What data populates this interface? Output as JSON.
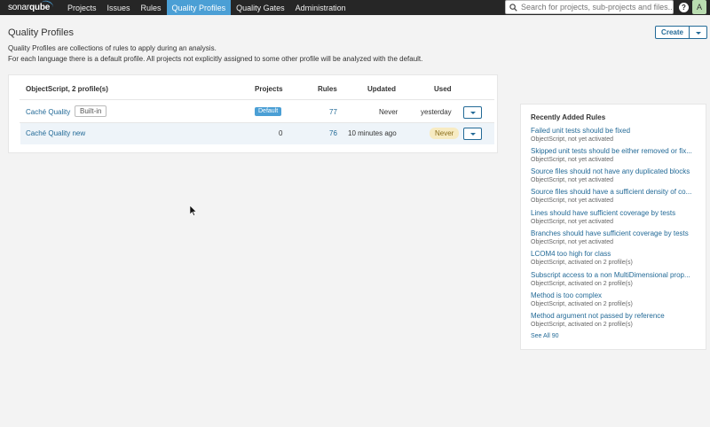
{
  "nav": {
    "logo_part1": "sonar",
    "logo_part2": "qube",
    "items": [
      {
        "label": "Projects",
        "active": false
      },
      {
        "label": "Issues",
        "active": false
      },
      {
        "label": "Rules",
        "active": false
      },
      {
        "label": "Quality Profiles",
        "active": true
      },
      {
        "label": "Quality Gates",
        "active": false
      },
      {
        "label": "Administration",
        "active": false
      }
    ],
    "search_placeholder": "Search for projects, sub-projects and files...",
    "help_label": "?",
    "avatar_letter": "A"
  },
  "page": {
    "title": "Quality Profiles",
    "description_line1": "Quality Profiles are collections of rules to apply during an analysis.",
    "description_line2": "For each language there is a default profile. All projects not explicitly assigned to some other profile will be analyzed with the default.",
    "create_label": "Create"
  },
  "profiles": {
    "header": {
      "language": "ObjectScript, 2 profile(s)",
      "projects": "Projects",
      "rules": "Rules",
      "updated": "Updated",
      "used": "Used"
    },
    "rows": [
      {
        "name": "Caché Quality",
        "builtin": "Built-in",
        "projects_badge": "Default",
        "projects": "",
        "rules": "77",
        "updated": "Never",
        "used": "yesterday"
      },
      {
        "name": "Caché Quality new",
        "builtin": "",
        "projects_badge": "",
        "projects": "0",
        "rules": "76",
        "updated": "10 minutes ago",
        "used": "Never"
      }
    ]
  },
  "recent_rules": {
    "title": "Recently Added Rules",
    "items": [
      {
        "name": "Failed unit tests should be fixed",
        "meta": "ObjectScript, not yet activated"
      },
      {
        "name": "Skipped unit tests should be either removed or fix...",
        "meta": "ObjectScript, not yet activated"
      },
      {
        "name": "Source files should not have any duplicated blocks",
        "meta": "ObjectScript, not yet activated"
      },
      {
        "name": "Source files should have a sufficient density of co...",
        "meta": "ObjectScript, not yet activated"
      },
      {
        "name": "Lines should have sufficient coverage by tests",
        "meta": "ObjectScript, not yet activated"
      },
      {
        "name": "Branches should have sufficient coverage by tests",
        "meta": "ObjectScript, not yet activated"
      },
      {
        "name": "LCOM4 too high for class",
        "meta": "ObjectScript, activated on 2 profile(s)"
      },
      {
        "name": "Subscript access to a non MultiDimensional prop...",
        "meta": "ObjectScript, activated on 2 profile(s)"
      },
      {
        "name": "Method is too complex",
        "meta": "ObjectScript, activated on 2 profile(s)"
      },
      {
        "name": "Method argument not passed by reference",
        "meta": "ObjectScript, activated on 2 profile(s)"
      }
    ],
    "see_all": "See All 90"
  },
  "colors": {
    "nav_bg": "#262626",
    "accent": "#4b9fd5",
    "link": "#236a97"
  }
}
